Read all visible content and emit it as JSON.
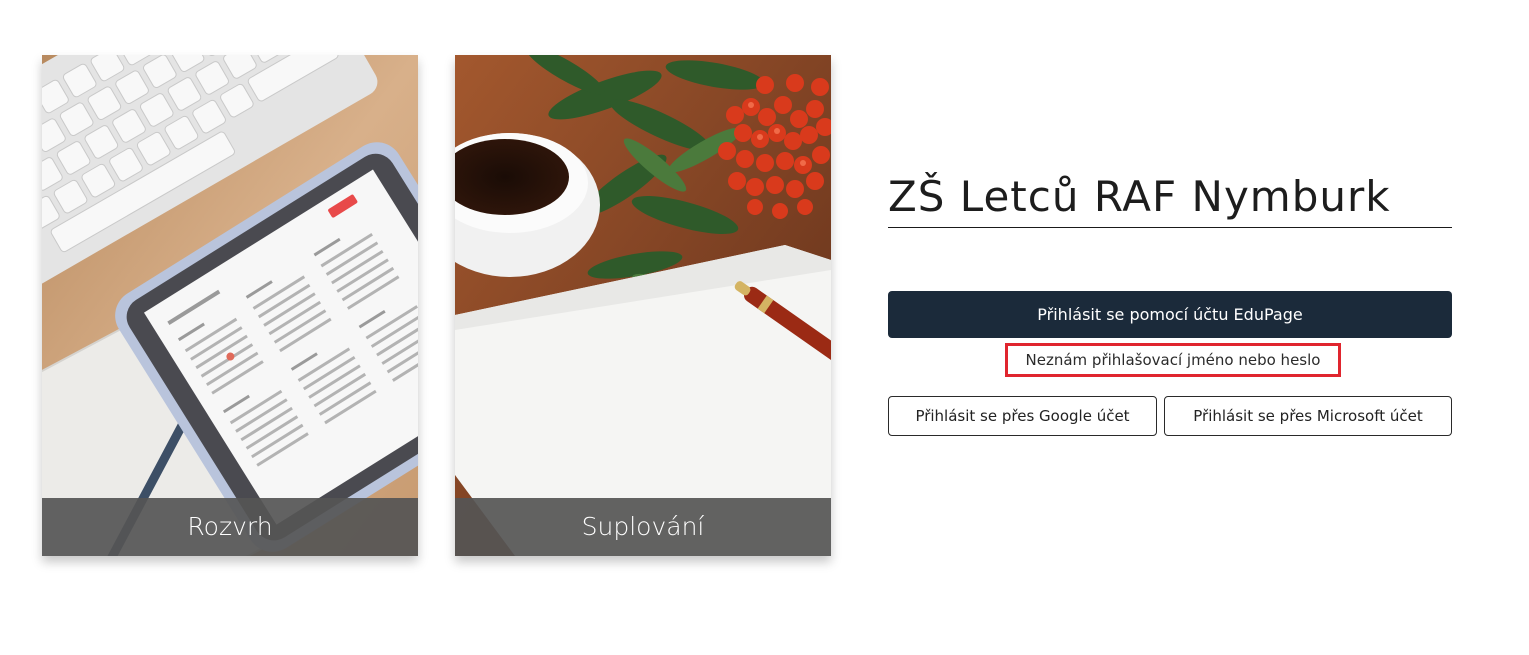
{
  "tiles": {
    "rozvrh": {
      "label": "Rozvrh"
    },
    "suplovani": {
      "label": "Suplování"
    }
  },
  "login": {
    "school_name": "ZŠ Letců RAF Nymburk",
    "edupage_button": "Přihlásit se pomocí účtu EduPage",
    "forgot_link": "Neznám přihlašovací jméno nebo heslo",
    "google_button": "Přihlásit se přes Google účet",
    "microsoft_button": "Přihlásit se přes Microsoft účet"
  },
  "colors": {
    "primary_button": "#1b2a3a",
    "highlight_border": "#e0252e",
    "caption_overlay": "#555555"
  }
}
